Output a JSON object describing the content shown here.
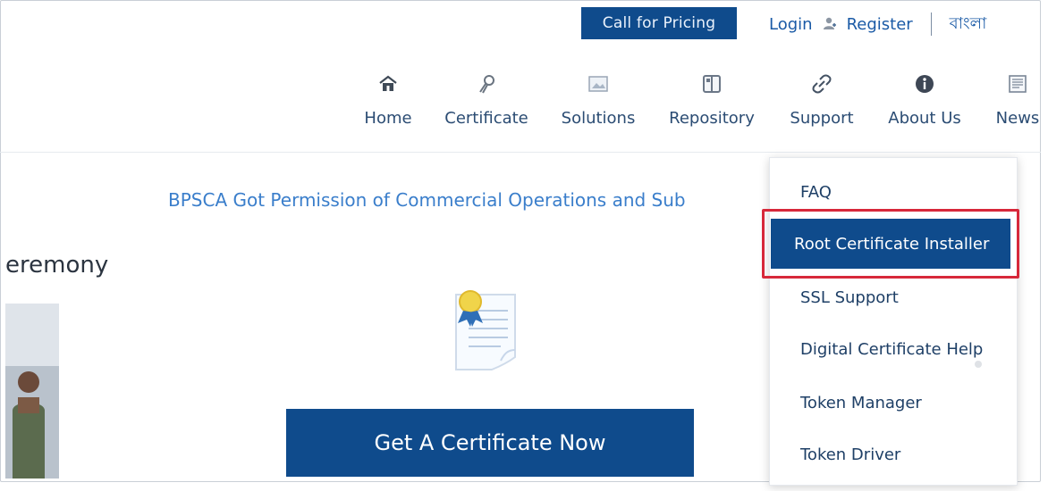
{
  "header": {
    "call_for_pricing": "Call for Pricing",
    "login": "Login",
    "register": "Register",
    "language": "বাংলা"
  },
  "nav": {
    "items": [
      {
        "label": "Home",
        "icon": "home-icon"
      },
      {
        "label": "Certificate",
        "icon": "ribbon-icon"
      },
      {
        "label": "Solutions",
        "icon": "image-icon"
      },
      {
        "label": "Repository",
        "icon": "book-icon"
      },
      {
        "label": "Support",
        "icon": "link-icon"
      },
      {
        "label": "About Us",
        "icon": "info-icon"
      },
      {
        "label": "News",
        "icon": "news-icon"
      }
    ]
  },
  "main": {
    "announcement": "BPSCA Got Permission of Commercial Operations and Sub",
    "ceremony_heading": "eremony",
    "cta_label": "Get A Certificate Now"
  },
  "support_menu": {
    "items": [
      "FAQ",
      "Root Certificate Installer",
      "SSL Support",
      "Digital Certificate Help",
      "Token Manager",
      "Token Driver"
    ],
    "selected_index": 1
  },
  "colors": {
    "primary": "#0f4b8c",
    "link": "#1a5aa6",
    "announcement": "#3a7ecb",
    "highlight_border": "#d7283a"
  }
}
